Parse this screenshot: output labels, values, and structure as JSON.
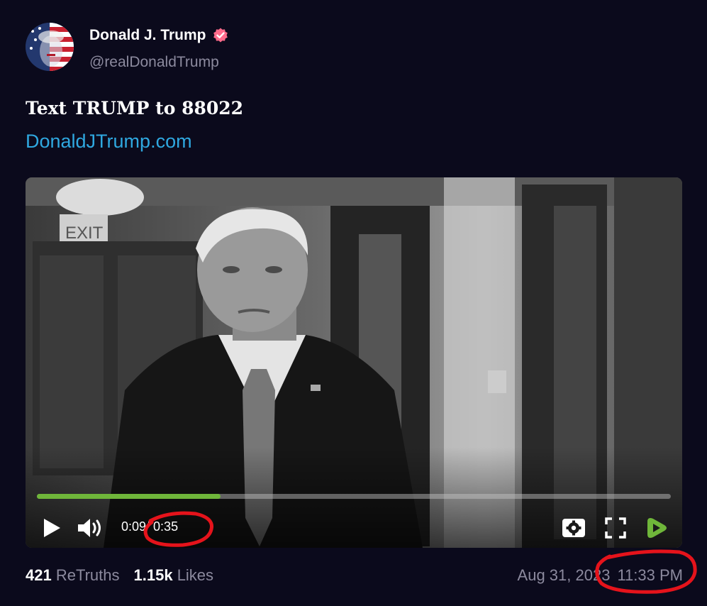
{
  "author": {
    "display_name": "Donald J. Trump",
    "handle": "@realDonaldTrump",
    "verified_icon": "verified-badge-icon"
  },
  "post": {
    "text": "Text TRUMP to 88022",
    "link_text": "DonaldJTrump.com"
  },
  "video": {
    "current_time": "0:09",
    "duration": "/ 0:35",
    "progress_fraction": 0.29,
    "accent_color": "#6fb63a",
    "icons": [
      "play-icon",
      "volume-icon",
      "settings-icon",
      "fullscreen-icon",
      "rumble-logo-icon"
    ]
  },
  "stats": {
    "retruths_count": "421",
    "retruths_label": "ReTruths",
    "likes_count": "1.15k",
    "likes_label": "Likes"
  },
  "meta": {
    "date": "Aug 31, 2023",
    "time": "11:33 PM"
  },
  "colors": {
    "background": "#0b0a1c",
    "link": "#2fa8e0",
    "verified": "#ff6b8b",
    "annotation": "#e5131b"
  }
}
